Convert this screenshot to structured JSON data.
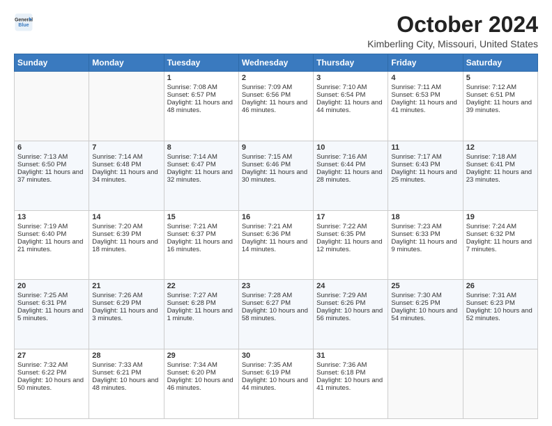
{
  "header": {
    "logo_line1": "General",
    "logo_line2": "Blue",
    "title": "October 2024",
    "subtitle": "Kimberling City, Missouri, United States"
  },
  "days_of_week": [
    "Sunday",
    "Monday",
    "Tuesday",
    "Wednesday",
    "Thursday",
    "Friday",
    "Saturday"
  ],
  "weeks": [
    [
      {
        "day": "",
        "sunrise": "",
        "sunset": "",
        "daylight": ""
      },
      {
        "day": "",
        "sunrise": "",
        "sunset": "",
        "daylight": ""
      },
      {
        "day": "1",
        "sunrise": "Sunrise: 7:08 AM",
        "sunset": "Sunset: 6:57 PM",
        "daylight": "Daylight: 11 hours and 48 minutes."
      },
      {
        "day": "2",
        "sunrise": "Sunrise: 7:09 AM",
        "sunset": "Sunset: 6:56 PM",
        "daylight": "Daylight: 11 hours and 46 minutes."
      },
      {
        "day": "3",
        "sunrise": "Sunrise: 7:10 AM",
        "sunset": "Sunset: 6:54 PM",
        "daylight": "Daylight: 11 hours and 44 minutes."
      },
      {
        "day": "4",
        "sunrise": "Sunrise: 7:11 AM",
        "sunset": "Sunset: 6:53 PM",
        "daylight": "Daylight: 11 hours and 41 minutes."
      },
      {
        "day": "5",
        "sunrise": "Sunrise: 7:12 AM",
        "sunset": "Sunset: 6:51 PM",
        "daylight": "Daylight: 11 hours and 39 minutes."
      }
    ],
    [
      {
        "day": "6",
        "sunrise": "Sunrise: 7:13 AM",
        "sunset": "Sunset: 6:50 PM",
        "daylight": "Daylight: 11 hours and 37 minutes."
      },
      {
        "day": "7",
        "sunrise": "Sunrise: 7:14 AM",
        "sunset": "Sunset: 6:48 PM",
        "daylight": "Daylight: 11 hours and 34 minutes."
      },
      {
        "day": "8",
        "sunrise": "Sunrise: 7:14 AM",
        "sunset": "Sunset: 6:47 PM",
        "daylight": "Daylight: 11 hours and 32 minutes."
      },
      {
        "day": "9",
        "sunrise": "Sunrise: 7:15 AM",
        "sunset": "Sunset: 6:46 PM",
        "daylight": "Daylight: 11 hours and 30 minutes."
      },
      {
        "day": "10",
        "sunrise": "Sunrise: 7:16 AM",
        "sunset": "Sunset: 6:44 PM",
        "daylight": "Daylight: 11 hours and 28 minutes."
      },
      {
        "day": "11",
        "sunrise": "Sunrise: 7:17 AM",
        "sunset": "Sunset: 6:43 PM",
        "daylight": "Daylight: 11 hours and 25 minutes."
      },
      {
        "day": "12",
        "sunrise": "Sunrise: 7:18 AM",
        "sunset": "Sunset: 6:41 PM",
        "daylight": "Daylight: 11 hours and 23 minutes."
      }
    ],
    [
      {
        "day": "13",
        "sunrise": "Sunrise: 7:19 AM",
        "sunset": "Sunset: 6:40 PM",
        "daylight": "Daylight: 11 hours and 21 minutes."
      },
      {
        "day": "14",
        "sunrise": "Sunrise: 7:20 AM",
        "sunset": "Sunset: 6:39 PM",
        "daylight": "Daylight: 11 hours and 18 minutes."
      },
      {
        "day": "15",
        "sunrise": "Sunrise: 7:21 AM",
        "sunset": "Sunset: 6:37 PM",
        "daylight": "Daylight: 11 hours and 16 minutes."
      },
      {
        "day": "16",
        "sunrise": "Sunrise: 7:21 AM",
        "sunset": "Sunset: 6:36 PM",
        "daylight": "Daylight: 11 hours and 14 minutes."
      },
      {
        "day": "17",
        "sunrise": "Sunrise: 7:22 AM",
        "sunset": "Sunset: 6:35 PM",
        "daylight": "Daylight: 11 hours and 12 minutes."
      },
      {
        "day": "18",
        "sunrise": "Sunrise: 7:23 AM",
        "sunset": "Sunset: 6:33 PM",
        "daylight": "Daylight: 11 hours and 9 minutes."
      },
      {
        "day": "19",
        "sunrise": "Sunrise: 7:24 AM",
        "sunset": "Sunset: 6:32 PM",
        "daylight": "Daylight: 11 hours and 7 minutes."
      }
    ],
    [
      {
        "day": "20",
        "sunrise": "Sunrise: 7:25 AM",
        "sunset": "Sunset: 6:31 PM",
        "daylight": "Daylight: 11 hours and 5 minutes."
      },
      {
        "day": "21",
        "sunrise": "Sunrise: 7:26 AM",
        "sunset": "Sunset: 6:29 PM",
        "daylight": "Daylight: 11 hours and 3 minutes."
      },
      {
        "day": "22",
        "sunrise": "Sunrise: 7:27 AM",
        "sunset": "Sunset: 6:28 PM",
        "daylight": "Daylight: 11 hours and 1 minute."
      },
      {
        "day": "23",
        "sunrise": "Sunrise: 7:28 AM",
        "sunset": "Sunset: 6:27 PM",
        "daylight": "Daylight: 10 hours and 58 minutes."
      },
      {
        "day": "24",
        "sunrise": "Sunrise: 7:29 AM",
        "sunset": "Sunset: 6:26 PM",
        "daylight": "Daylight: 10 hours and 56 minutes."
      },
      {
        "day": "25",
        "sunrise": "Sunrise: 7:30 AM",
        "sunset": "Sunset: 6:25 PM",
        "daylight": "Daylight: 10 hours and 54 minutes."
      },
      {
        "day": "26",
        "sunrise": "Sunrise: 7:31 AM",
        "sunset": "Sunset: 6:23 PM",
        "daylight": "Daylight: 10 hours and 52 minutes."
      }
    ],
    [
      {
        "day": "27",
        "sunrise": "Sunrise: 7:32 AM",
        "sunset": "Sunset: 6:22 PM",
        "daylight": "Daylight: 10 hours and 50 minutes."
      },
      {
        "day": "28",
        "sunrise": "Sunrise: 7:33 AM",
        "sunset": "Sunset: 6:21 PM",
        "daylight": "Daylight: 10 hours and 48 minutes."
      },
      {
        "day": "29",
        "sunrise": "Sunrise: 7:34 AM",
        "sunset": "Sunset: 6:20 PM",
        "daylight": "Daylight: 10 hours and 46 minutes."
      },
      {
        "day": "30",
        "sunrise": "Sunrise: 7:35 AM",
        "sunset": "Sunset: 6:19 PM",
        "daylight": "Daylight: 10 hours and 44 minutes."
      },
      {
        "day": "31",
        "sunrise": "Sunrise: 7:36 AM",
        "sunset": "Sunset: 6:18 PM",
        "daylight": "Daylight: 10 hours and 41 minutes."
      },
      {
        "day": "",
        "sunrise": "",
        "sunset": "",
        "daylight": ""
      },
      {
        "day": "",
        "sunrise": "",
        "sunset": "",
        "daylight": ""
      }
    ]
  ]
}
